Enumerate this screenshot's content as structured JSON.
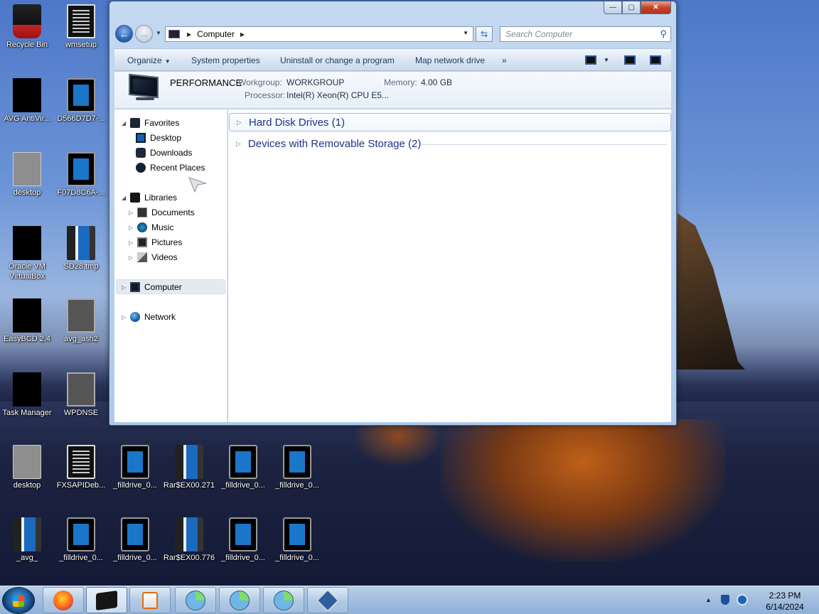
{
  "desktop": {
    "icons": [
      {
        "label": "Recycle Bin"
      },
      {
        "label": "wmsetup"
      },
      {
        "label": "AVG AntiVir..."
      },
      {
        "label": "D566D7D7-..."
      },
      {
        "label": "desktop"
      },
      {
        "label": "F07D8C6A-..."
      },
      {
        "label": "Oracle VM VirtualBox"
      },
      {
        "label": "SD28.tmp"
      },
      {
        "label": "EasyBCD 2.4"
      },
      {
        "label": "avg_ash2"
      },
      {
        "label": "Task Manager"
      },
      {
        "label": "WPDNSE"
      },
      {
        "label": "desktop"
      },
      {
        "label": "FXSAPIDeb..."
      },
      {
        "label": "_filldrive_0..."
      },
      {
        "label": "Rar$EX00.271"
      },
      {
        "label": "_filldrive_0..."
      },
      {
        "label": "_filldrive_0..."
      },
      {
        "label": "_avg_"
      },
      {
        "label": "_filldrive_0..."
      },
      {
        "label": "_filldrive_0..."
      },
      {
        "label": "Rar$EX00.776"
      },
      {
        "label": "_filldrive_0..."
      },
      {
        "label": "_filldrive_0..."
      }
    ]
  },
  "window": {
    "controls": {
      "minimize": "—",
      "maximize": "▢",
      "close": "✕"
    },
    "address": {
      "root_icon": "computer-icon",
      "path": "Computer"
    },
    "search": {
      "placeholder": "Search Computer"
    },
    "toolbar": {
      "organize": "Organize",
      "system_properties": "System properties",
      "uninstall": "Uninstall or change a program",
      "map_drive": "Map network drive",
      "more": "»"
    },
    "details": {
      "name": "PERFORMANCE",
      "workgroup_label": "Workgroup:",
      "workgroup_value": "WORKGROUP",
      "memory_label": "Memory:",
      "memory_value": "4.00 GB",
      "processor_label": "Processor:",
      "processor_value": "Intel(R) Xeon(R) CPU E5..."
    },
    "nav_pane": {
      "favorites": "Favorites",
      "desktop": "Desktop",
      "downloads": "Downloads",
      "recent_places": "Recent Places",
      "libraries": "Libraries",
      "documents": "Documents",
      "music": "Music",
      "pictures": "Pictures",
      "videos": "Videos",
      "computer": "Computer",
      "network": "Network"
    },
    "groups": [
      {
        "label": "Hard Disk Drives (1)"
      },
      {
        "label": "Devices with Removable Storage (2)"
      }
    ]
  },
  "taskbar": {
    "clock_time": "2:23 PM",
    "clock_date": "6/14/2024",
    "tray_up": "▲"
  }
}
